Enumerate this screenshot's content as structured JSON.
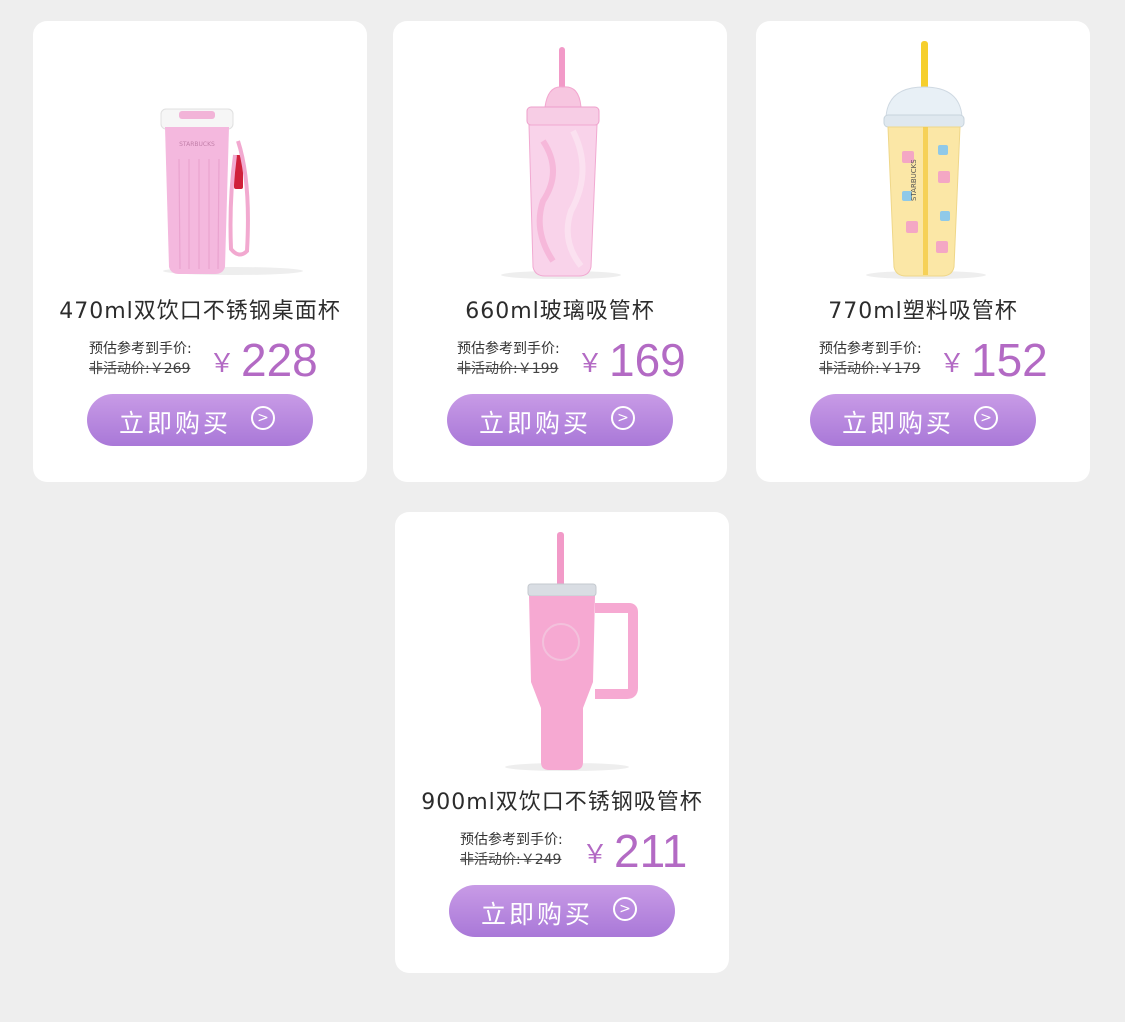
{
  "products": [
    {
      "title": "470ml双饮口不锈钢桌面杯",
      "est_label": "预估参考到手价:",
      "orig_price": "非活动价:￥269",
      "currency": "￥",
      "price": "228",
      "buy_label": "立即购买",
      "image_icon": "pink-stainless-tumbler-with-strap"
    },
    {
      "title": "660ml玻璃吸管杯",
      "est_label": "预估参考到手价:",
      "orig_price": "非活动价:￥199",
      "currency": "￥",
      "price": "169",
      "buy_label": "立即购买",
      "image_icon": "pink-glass-straw-cup"
    },
    {
      "title": "770ml塑料吸管杯",
      "est_label": "预估参考到手价:",
      "orig_price": "非活动价:￥179",
      "currency": "￥",
      "price": "152",
      "buy_label": "立即购买",
      "image_icon": "yellow-plastic-straw-cup"
    },
    {
      "title": "900ml双饮口不锈钢吸管杯",
      "est_label": "预估参考到手价:",
      "orig_price": "非活动价:￥249",
      "currency": "￥",
      "price": "211",
      "buy_label": "立即购买",
      "image_icon": "pink-stainless-handle-tumbler"
    }
  ],
  "arrow_glyph": ">",
  "colors": {
    "background": "#eeeeee",
    "card": "#ffffff",
    "price": "#b36ac4",
    "button_top": "#c89be6",
    "button_bottom": "#a978d8"
  }
}
